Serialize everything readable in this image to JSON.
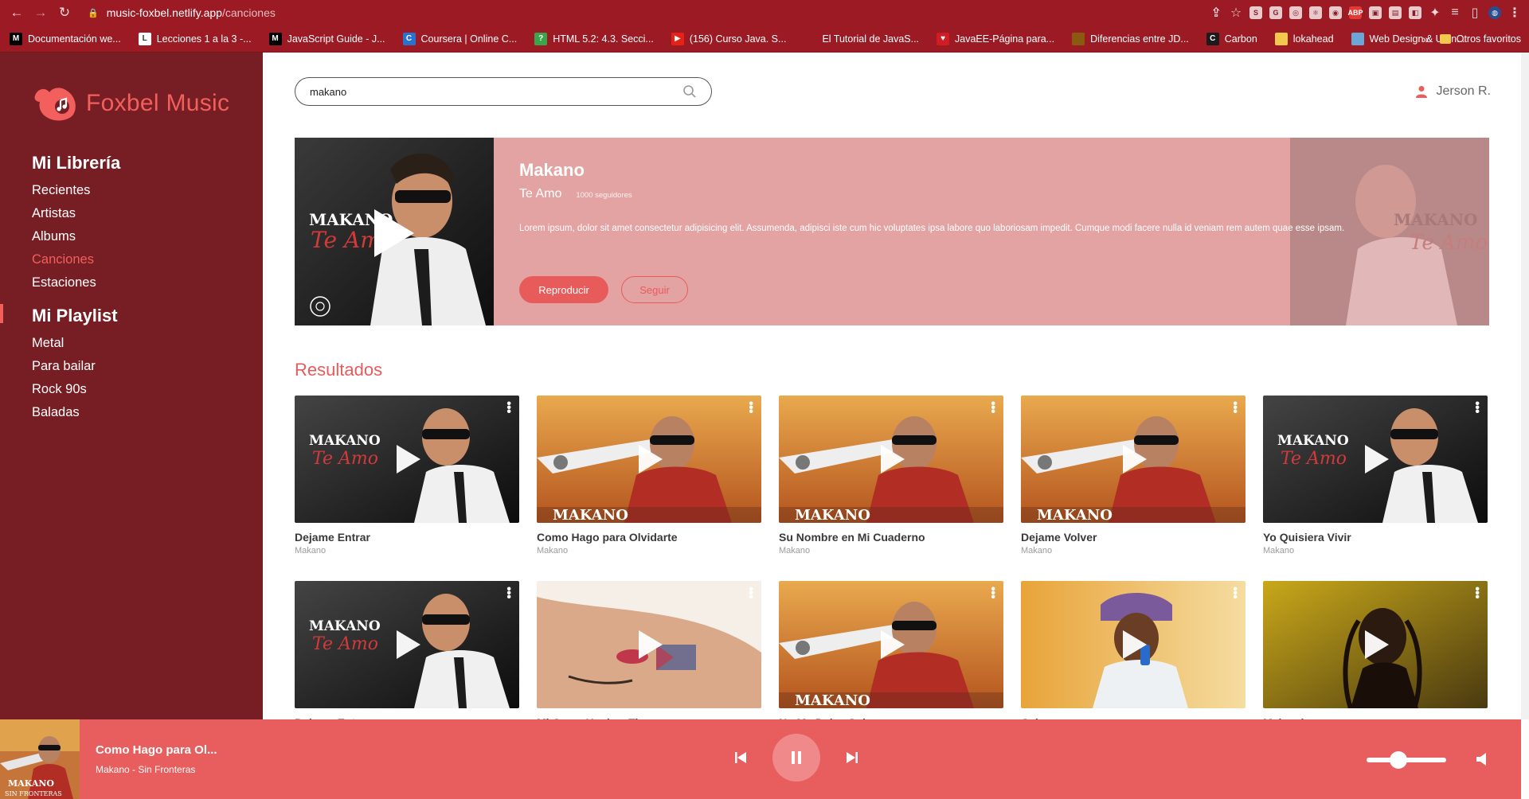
{
  "browser": {
    "url_host": "music-foxbel.netlify.app",
    "url_path": "/canciones",
    "bookmarks": [
      {
        "label": "Documentación we...",
        "icon": "M",
        "color": "#000000"
      },
      {
        "label": "Lecciones 1 a la 3 -...",
        "icon": "L",
        "color": "#ffffff"
      },
      {
        "label": "JavaScript Guide - J...",
        "icon": "M",
        "color": "#000000"
      },
      {
        "label": "Coursera | Online C...",
        "icon": "C",
        "color": "#2a73cc"
      },
      {
        "label": "HTML 5.2: 4.3. Secci...",
        "icon": "?",
        "color": "#3aa64a"
      },
      {
        "label": "(156) Curso Java. S...",
        "icon": "▶",
        "color": "#e62117"
      },
      {
        "label": "El Tutorial de JavaS...",
        "icon": "",
        "color": "#9b1a23"
      },
      {
        "label": "JavaEE-Página para...",
        "icon": "♥",
        "color": "#d01c24"
      },
      {
        "label": "Diferencias entre JD...",
        "icon": "",
        "color": "#8a5a10"
      },
      {
        "label": "Carbon",
        "icon": "C",
        "color": "#1b1b1b"
      },
      {
        "label": "lokahead",
        "icon": "",
        "color": "#f2c94c"
      },
      {
        "label": "Web Design & UI In...",
        "icon": "",
        "color": "#6aa6d8"
      }
    ],
    "bookmarks_more": "»",
    "other_bookmarks": "Otros favoritos"
  },
  "sidebar": {
    "logo_text": "Foxbel Music",
    "library_title": "Mi Librería",
    "library_items": [
      "Recientes",
      "Artistas",
      "Albums",
      "Canciones",
      "Estaciones"
    ],
    "active_item": "Canciones",
    "playlist_title": "Mi Playlist",
    "playlist_items": [
      "Metal",
      "Para bailar",
      "Rock 90s",
      "Baladas"
    ]
  },
  "header": {
    "search_value": "makano",
    "user_name": "Jerson R."
  },
  "hero": {
    "artist": "Makano",
    "song": "Te Amo",
    "followers": "1000 seguidores",
    "description": "Lorem ipsum, dolor sit amet consectetur adipisicing elit. Assumenda, adipisci iste cum hic voluptates ipsa labore quo laboriosam impedit. Cumque modi facere nulla id veniam rem autem quae esse ipsam.",
    "play_label": "Reproducir",
    "follow_label": "Seguir"
  },
  "results": {
    "title": "Resultados",
    "items": [
      {
        "title": "Dejame Entrar",
        "artist": "Makano",
        "art": "makano-dark"
      },
      {
        "title": "Como Hago para Olvidarte",
        "artist": "Makano",
        "art": "makano-plane"
      },
      {
        "title": "Su Nombre en Mi Cuaderno",
        "artist": "Makano",
        "art": "makano-plane"
      },
      {
        "title": "Dejame Volver",
        "artist": "Makano",
        "art": "makano-plane"
      },
      {
        "title": "Yo Quisiera Vivir",
        "artist": "Makano",
        "art": "makano-dark"
      },
      {
        "title": "Dejame Entrar",
        "artist": "",
        "art": "makano-dark"
      },
      {
        "title": "Mi Cama Huele a Ti",
        "artist": "",
        "art": "face"
      },
      {
        "title": "No Me Dejes Solo",
        "artist": "",
        "art": "makano-plane"
      },
      {
        "title": "Cabeza",
        "artist": "",
        "art": "cabeza"
      },
      {
        "title": "Makambo",
        "artist": "",
        "art": "makambo"
      }
    ]
  },
  "player": {
    "title": "Como Hago para Ol...",
    "subtitle": "Makano - Sin Fronteras",
    "volume": 0.4
  },
  "colors": {
    "accent": "#e85d5d",
    "sidebar": "#771e24",
    "browser": "#9b1a23"
  }
}
